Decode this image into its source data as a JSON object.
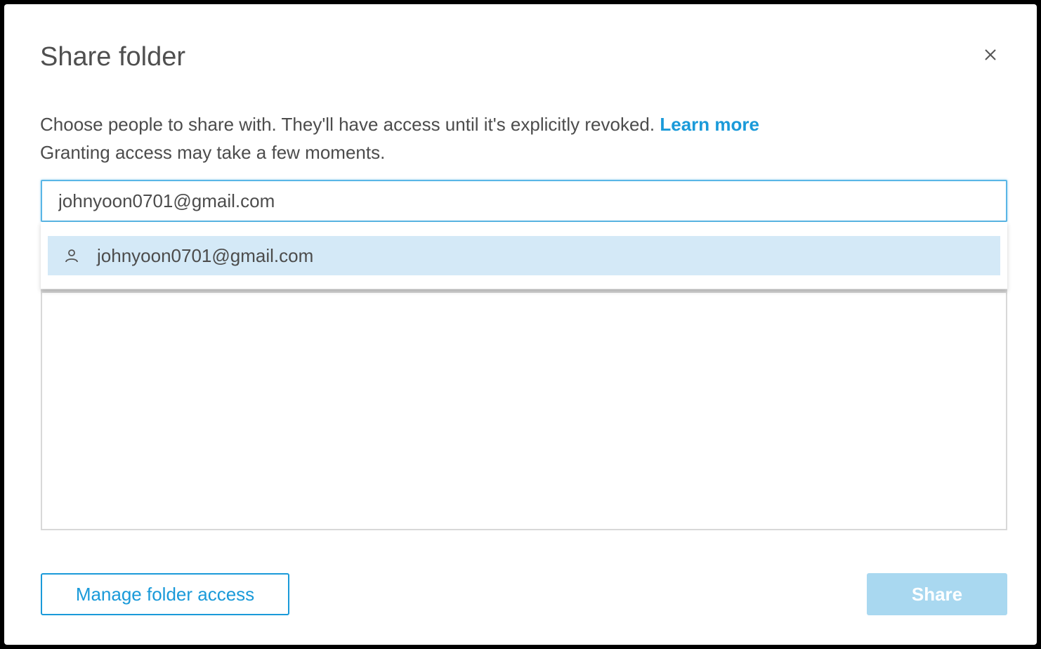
{
  "dialog": {
    "title": "Share folder",
    "close_icon": "close-icon",
    "description_line1": "Choose people to share with. They'll have access until it's explicitly revoked.",
    "learn_more_label": "Learn more",
    "description_line2": "Granting access may take a few moments."
  },
  "search": {
    "value": "johnyoon0701@gmail.com",
    "placeholder": ""
  },
  "dropdown": {
    "options": [
      {
        "icon": "user-icon",
        "label": "johnyoon0701@gmail.com"
      }
    ]
  },
  "footer": {
    "manage_label": "Manage folder access",
    "share_label": "Share",
    "share_enabled": false
  },
  "colors": {
    "accent": "#1a9ad9",
    "option_highlight": "#d4e9f7",
    "share_disabled_bg": "#a9d8f0",
    "text": "#4c4c4c"
  }
}
